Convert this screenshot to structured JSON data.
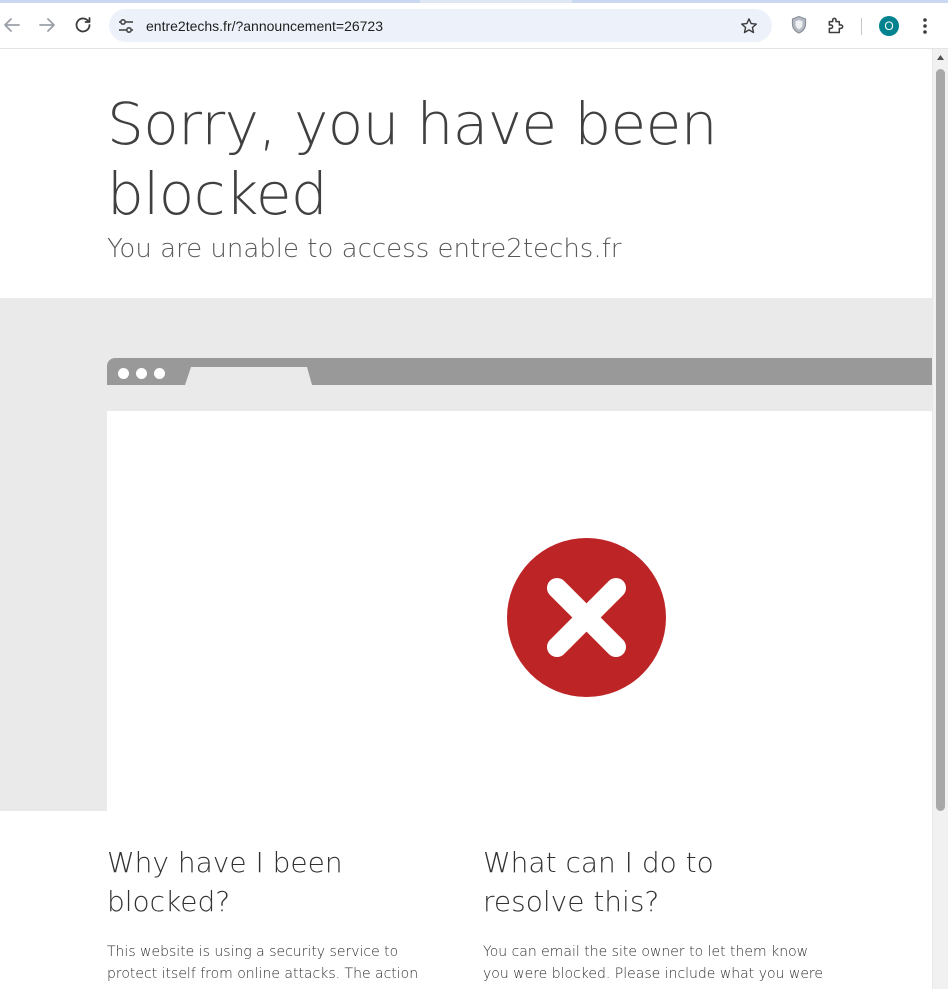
{
  "browser": {
    "url": "entre2techs.fr/?announcement=26723",
    "profile_initial": "O",
    "icons": {
      "back": "arrow-left-icon",
      "forward": "arrow-right-icon",
      "reload": "reload-icon",
      "site_info": "tune-icon",
      "bookmark": "star-icon",
      "extension_shield": "shield-icon",
      "extensions": "puzzle-icon",
      "menu": "more-vertical-icon"
    }
  },
  "page": {
    "title": "Sorry, you have been blocked",
    "subtitle": "You are unable to access entre2techs.fr",
    "illustration": {
      "icon": "blocked-x-icon",
      "color": "#bd2426"
    },
    "why": {
      "heading": "Why have I been blocked?",
      "text": "This website is using a security service to protect itself from online attacks. The action you just performed triggered the security solution. There"
    },
    "resolve": {
      "heading": "What can I do to resolve this?",
      "text": "You can email the site owner to let them know you were blocked. Please include what you were doing when this page came up and the Cloudflare"
    }
  }
}
